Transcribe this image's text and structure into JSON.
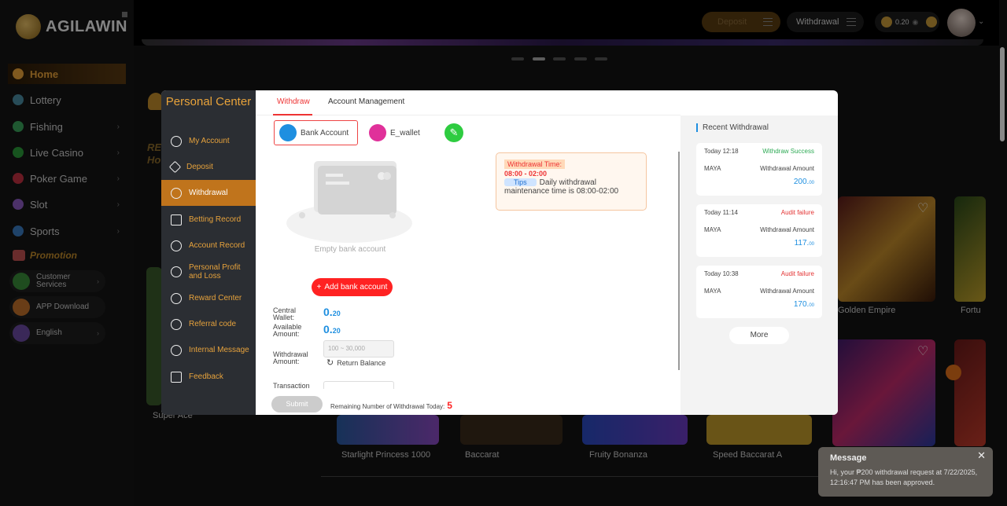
{
  "brand": {
    "name": "AGILAWIN"
  },
  "sidebar": {
    "items": [
      {
        "label": "Home",
        "icon": "home-icon"
      },
      {
        "label": "Lottery",
        "icon": "lottery-icon"
      },
      {
        "label": "Fishing",
        "icon": "fishing-icon"
      },
      {
        "label": "Live Casino",
        "icon": "live-casino-icon"
      },
      {
        "label": "Poker Game",
        "icon": "poker-icon"
      },
      {
        "label": "Slot",
        "icon": "slot-icon"
      },
      {
        "label": "Sports",
        "icon": "sports-icon"
      }
    ],
    "promotion": "Promotion",
    "customer_services": "Customer Services",
    "app_download": "APP Download",
    "language": "English"
  },
  "topbar": {
    "deposit": "Deposit",
    "withdrawal": "Withdrawal",
    "balance": "0.20"
  },
  "background": {
    "games": [
      "Golden Empire",
      "Fortu",
      "Super Ace",
      "Starlight Princess 1000",
      "Baccarat",
      "Fruity Bonanza",
      "Speed Baccarat A"
    ],
    "headline_partial": "RE",
    "headline_partial2": "Ho"
  },
  "personal_center": {
    "title": "Personal Center",
    "menu": [
      {
        "label": "My Account",
        "icon": "user-icon"
      },
      {
        "label": "Deposit",
        "icon": "deposit-icon"
      },
      {
        "label": "Withdrawal",
        "icon": "withdrawal-icon"
      },
      {
        "label": "Betting Record",
        "icon": "betting-record-icon"
      },
      {
        "label": "Account Record",
        "icon": "account-record-icon"
      },
      {
        "label": "Personal Profit and Loss",
        "icon": "profit-loss-icon"
      },
      {
        "label": "Reward Center",
        "icon": "reward-icon"
      },
      {
        "label": "Referral code",
        "icon": "referral-icon"
      },
      {
        "label": "Internal Message",
        "icon": "message-icon"
      },
      {
        "label": "Feedback",
        "icon": "feedback-icon"
      }
    ]
  },
  "withdraw": {
    "tabs": [
      "Withdraw",
      "Account Management"
    ],
    "bank_account": "Bank Account",
    "ewallet": "E_wallet",
    "empty_text": "Empty bank account",
    "add_button": "Add bank account",
    "central_wallet_label": "Central Wallet:",
    "central_wallet_int": "0.",
    "central_wallet_dec": "20",
    "available_label": "Available Amount:",
    "available_int": "0.",
    "available_dec": "20",
    "amount_label": "Withdrawal Amount:",
    "amount_placeholder": "100 ~ 30,000",
    "return_balance": "Return Balance",
    "transaction_label": "Transaction",
    "submit": "Submit",
    "remaining_label": "Remaining Number of Withdrawal Today:",
    "remaining_count": "5",
    "tip_title": "Withdrawal Time:",
    "tip_time": "08:00  - 02:00",
    "tip_badge": "Tips",
    "tip_text1": "Daily withdrawal",
    "tip_text2": "maintenance time is 08:00-02:00"
  },
  "recent": {
    "title": "Recent Withdrawal",
    "items": [
      {
        "date": "Today 12:18",
        "status": "Withdraw Success",
        "status_color": "#2eaa55",
        "bank": "MAYA",
        "label": "Withdrawal Amount",
        "amount": "200.",
        "cents": "00"
      },
      {
        "date": "Today 11:14",
        "status": "Audit failure",
        "status_color": "#e33333",
        "bank": "MAYA",
        "label": "Withdrawal Amount",
        "amount": "117.",
        "cents": "00"
      },
      {
        "date": "Today 10:38",
        "status": "Audit failure",
        "status_color": "#e33333",
        "bank": "MAYA",
        "label": "Withdrawal Amount",
        "amount": "170.",
        "cents": "00"
      }
    ],
    "more": "More"
  },
  "toast": {
    "title": "Message",
    "text": "Hi, your ₱200 withdrawal request at 7/22/2025, 12:16:47 PM has been approved."
  }
}
